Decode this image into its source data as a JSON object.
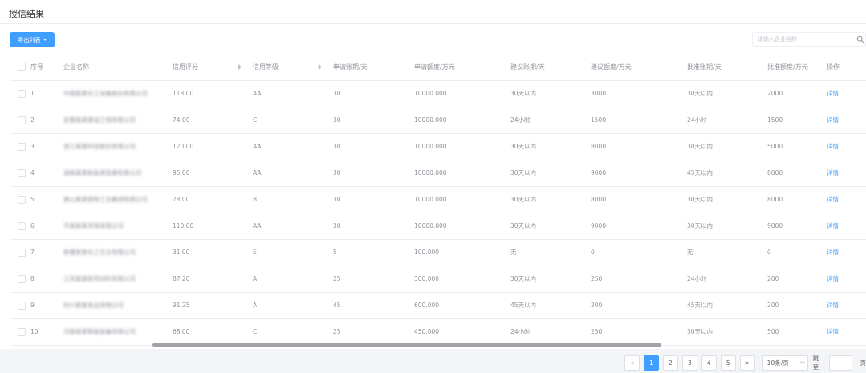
{
  "page": {
    "title": "授信结果"
  },
  "toolbar": {
    "export_label": "导出列表"
  },
  "search": {
    "placeholder": "请输入企业名称"
  },
  "table": {
    "headers": {
      "index": "序号",
      "company": "企业名称",
      "credit_score": "信用评分",
      "credit_grade": "信用等级",
      "apply_term": "申请账期/天",
      "apply_amount": "申请额度/万元",
      "suggest_term": "建议账期/天",
      "suggest_amount": "建议额度/万元",
      "approve_term": "批准账期/天",
      "approve_amount": "批准额度/万元",
      "action": "操作"
    },
    "rows": [
      {
        "index": "1",
        "company": "中国某某化工设备股份有限公司",
        "score": "118.00",
        "grade": "AA",
        "apply_term": "30",
        "apply_amount": "10000.000",
        "suggest_term": "30天以内",
        "suggest_amount": "3000",
        "approve_term": "30天以内",
        "approve_amount": "2000",
        "action": "详情"
      },
      {
        "index": "2",
        "company": "安徽某某建设工程有限公司",
        "score": "74.00",
        "grade": "C",
        "apply_term": "30",
        "apply_amount": "10000.000",
        "suggest_term": "24小时",
        "suggest_amount": "1500",
        "approve_term": "24小时",
        "approve_amount": "1500",
        "action": "详情"
      },
      {
        "index": "3",
        "company": "浙江某某科技股份有限公司",
        "score": "120.00",
        "grade": "AA",
        "apply_term": "30",
        "apply_amount": "10000.000",
        "suggest_term": "30天以内",
        "suggest_amount": "8000",
        "approve_term": "30天以内",
        "approve_amount": "5000",
        "action": "详情"
      },
      {
        "index": "4",
        "company": "湖南某某新能源发展有限公司",
        "score": "95.00",
        "grade": "AA",
        "apply_term": "30",
        "apply_amount": "10000.000",
        "suggest_term": "30天以内",
        "suggest_amount": "9000",
        "approve_term": "45天以内",
        "approve_amount": "8000",
        "action": "详情"
      },
      {
        "index": "5",
        "company": "唐山某某钢铁工业集团有限公司",
        "score": "78.00",
        "grade": "B",
        "apply_term": "30",
        "apply_amount": "10000.000",
        "suggest_term": "30天以内",
        "suggest_amount": "8000",
        "approve_term": "30天以内",
        "approve_amount": "8000",
        "action": "详情"
      },
      {
        "index": "6",
        "company": "华南某某贸易有限公司",
        "score": "110.00",
        "grade": "AA",
        "apply_term": "30",
        "apply_amount": "10000.000",
        "suggest_term": "30天以内",
        "suggest_amount": "9000",
        "approve_term": "30天以内",
        "approve_amount": "9000",
        "action": "详情"
      },
      {
        "index": "7",
        "company": "新疆某某化工实业有限公司",
        "score": "31.00",
        "grade": "E",
        "apply_term": "5",
        "apply_amount": "100.000",
        "suggest_term": "无",
        "suggest_amount": "0",
        "approve_term": "无",
        "approve_amount": "0",
        "action": "详情"
      },
      {
        "index": "8",
        "company": "江苏某某新型材料有限公司",
        "score": "87.20",
        "grade": "A",
        "apply_term": "25",
        "apply_amount": "300.000",
        "suggest_term": "30天以内",
        "suggest_amount": "250",
        "approve_term": "24小时",
        "approve_amount": "200",
        "action": "详情"
      },
      {
        "index": "9",
        "company": "四川某某食品有限公司",
        "score": "91.25",
        "grade": "A",
        "apply_term": "45",
        "apply_amount": "600.000",
        "suggest_term": "45天以内",
        "suggest_amount": "200",
        "approve_term": "45天以内",
        "approve_amount": "200",
        "action": "详情"
      },
      {
        "index": "10",
        "company": "河南某某智能装备有限公司",
        "score": "68.00",
        "grade": "C",
        "apply_term": "25",
        "apply_amount": "450.000",
        "suggest_term": "24小时",
        "suggest_amount": "250",
        "approve_term": "30天以内",
        "approve_amount": "500",
        "action": "详情"
      }
    ]
  },
  "pagination": {
    "prev": "<",
    "pages": [
      "1",
      "2",
      "3",
      "4",
      "5"
    ],
    "current": "1",
    "next": ">",
    "page_size": "10条/页",
    "jump_label": "跳至",
    "suffix": "页"
  },
  "colors": {
    "primary": "#409eff",
    "text": "#606266",
    "muted": "#909399",
    "border": "#ebeef5"
  }
}
